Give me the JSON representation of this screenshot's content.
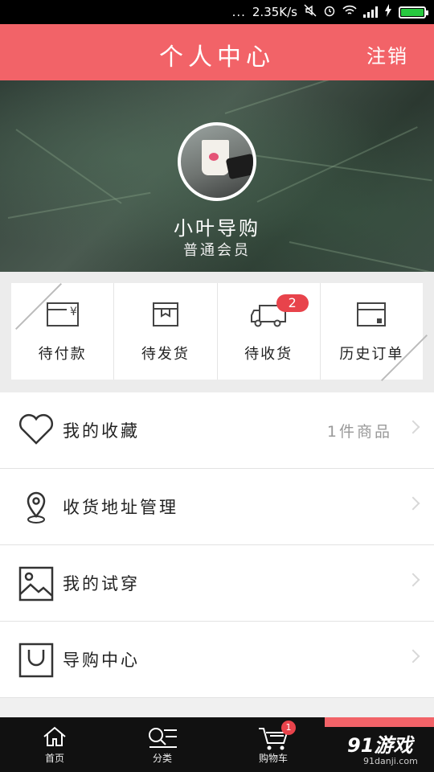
{
  "status_bar": {
    "dots": "...",
    "speed": "2.35K/s"
  },
  "header": {
    "title": "个人中心",
    "logout_label": "注销"
  },
  "profile": {
    "name": "小叶导购",
    "level": "普通会员"
  },
  "orders": {
    "items": [
      {
        "label": "待付款",
        "icon": "wallet-icon"
      },
      {
        "label": "待发货",
        "icon": "package-icon"
      },
      {
        "label": "待收货",
        "icon": "truck-icon",
        "badge": "2"
      },
      {
        "label": "历史订单",
        "icon": "calendar-icon"
      }
    ]
  },
  "menu": {
    "items": [
      {
        "label": "我的收藏",
        "extra": "1件商品",
        "icon": "heart-icon"
      },
      {
        "label": "收货地址管理",
        "icon": "location-pin-icon"
      },
      {
        "label": "我的试穿",
        "icon": "image-icon"
      },
      {
        "label": "导购中心",
        "icon": "shopping-bag-icon"
      }
    ]
  },
  "bottom_nav": {
    "items": [
      {
        "label": "首页",
        "icon": "home-icon"
      },
      {
        "label": "分类",
        "icon": "category-search-icon"
      },
      {
        "label": "购物车",
        "icon": "cart-icon",
        "badge": "1"
      }
    ]
  },
  "watermark": {
    "text": "91游戏",
    "sub": "91danji.com"
  },
  "colors": {
    "accent": "#f26368",
    "badge": "#e8434b",
    "battery": "#27c93f"
  }
}
